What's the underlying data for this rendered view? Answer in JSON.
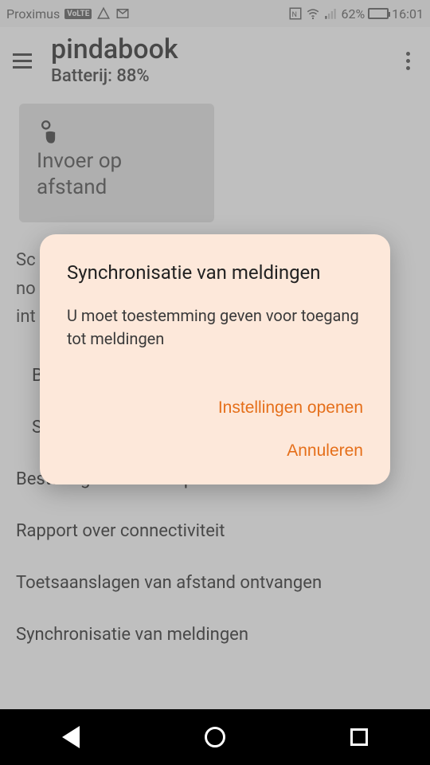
{
  "status": {
    "carrier": "Proximus",
    "volte": "VoLTE",
    "battery_pct": "62%",
    "time": "16:01"
  },
  "app": {
    "title": "pindabook",
    "subtitle": "Batterij: 88%"
  },
  "card": {
    "label": "Invoer op afstand"
  },
  "body_text": "Sc\nno\nint",
  "list": {
    "item0": "B",
    "item1": "S",
    "item2": "Besturing van mediaspeler",
    "item3": "Rapport over connectiviteit",
    "item4": "Toetsaanslagen van afstand ontvangen",
    "item5": "Synchronisatie van meldingen"
  },
  "dialog": {
    "title": "Synchronisatie van meldingen",
    "message": "U moet toestemming geven voor toegang tot meldingen",
    "primary": "Instellingen openen",
    "secondary": "Annuleren"
  }
}
